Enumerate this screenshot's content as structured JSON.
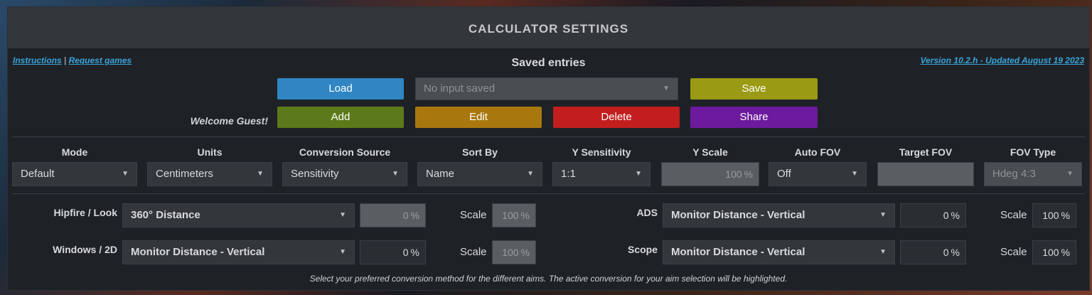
{
  "header": {
    "title": "CALCULATOR SETTINGS"
  },
  "links": {
    "instructions": "Instructions",
    "separator": "|",
    "request_games": "Request games",
    "version": "Version 10.2.h - Updated August 19 2023"
  },
  "saved": {
    "title": "Saved entries",
    "welcome": "Welcome Guest!",
    "select_placeholder": "No input saved",
    "buttons": {
      "load": "Load",
      "save": "Save",
      "add": "Add",
      "edit": "Edit",
      "delete": "Delete",
      "share": "Share"
    }
  },
  "settings": {
    "mode": {
      "label": "Mode",
      "value": "Default"
    },
    "units": {
      "label": "Units",
      "value": "Centimeters"
    },
    "conversion_source": {
      "label": "Conversion Source",
      "value": "Sensitivity"
    },
    "sort_by": {
      "label": "Sort By",
      "value": "Name"
    },
    "y_sensitivity": {
      "label": "Y Sensitivity",
      "value": "1:1"
    },
    "y_scale": {
      "label": "Y Scale",
      "value": "100",
      "unit": "%"
    },
    "auto_fov": {
      "label": "Auto FOV",
      "value": "Off"
    },
    "target_fov": {
      "label": "Target FOV",
      "value": ""
    },
    "fov_type": {
      "label": "FOV Type",
      "value": "Hdeg 4:3"
    }
  },
  "conversions": {
    "hipfire": {
      "label": "Hipfire / Look",
      "method": "360° Distance",
      "value": "0",
      "unit": "%",
      "scale_label": "Scale",
      "scale": "100",
      "scale_unit": "%"
    },
    "windows": {
      "label": "Windows / 2D",
      "method": "Monitor Distance - Vertical",
      "value": "0",
      "unit": "%",
      "scale_label": "Scale",
      "scale": "100",
      "scale_unit": "%"
    },
    "ads": {
      "label": "ADS",
      "method": "Monitor Distance - Vertical",
      "value": "0",
      "unit": "%",
      "scale_label": "Scale",
      "scale": "100",
      "scale_unit": "%"
    },
    "scope": {
      "label": "Scope",
      "method": "Monitor Distance - Vertical",
      "value": "0",
      "unit": "%",
      "scale_label": "Scale",
      "scale": "100",
      "scale_unit": "%"
    }
  },
  "footnote": "Select your preferred conversion method for the different aims. The active conversion for your aim selection will be highlighted.",
  "colors": {
    "load": "#2f86c2",
    "save": "#9a9a14",
    "add": "#5c7a1a",
    "edit": "#a8780f",
    "delete": "#c21e1e",
    "share": "#6d1a9e"
  }
}
